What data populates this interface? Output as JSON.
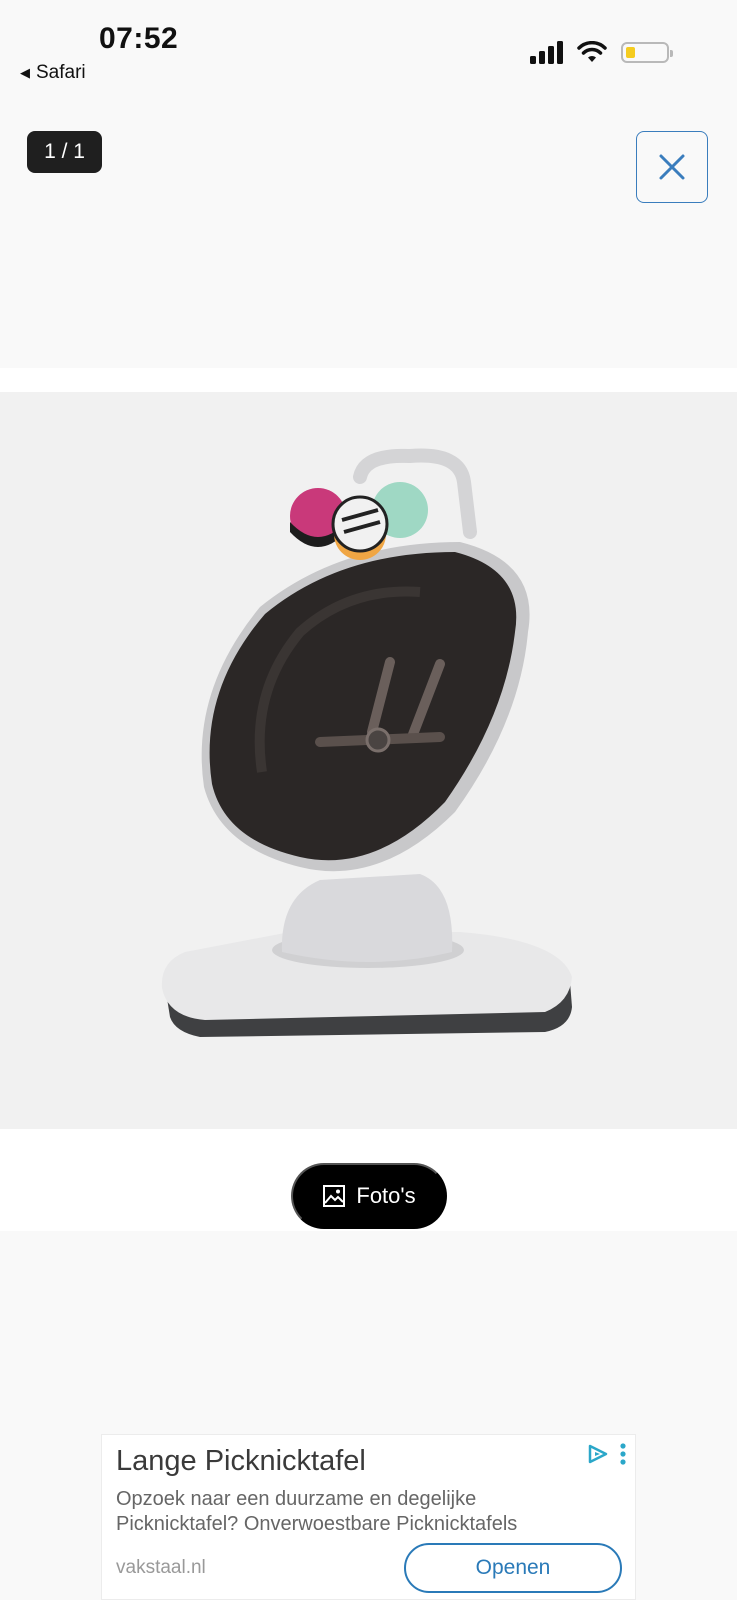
{
  "status_bar": {
    "time": "07:52",
    "back_label": "Safari",
    "battery_color": "#f5cc1f"
  },
  "gallery": {
    "counter": "1 / 1",
    "close_icon": "close-icon",
    "image_description_icon": "product-photo",
    "photos_button_label": "Foto's",
    "photos_icon": "image-icon",
    "accent_color": "#3a7dbd"
  },
  "ad": {
    "title": "Lange Picknicktafel",
    "body": "Opzoek naar een duurzame en degelijke Picknicktafel? Onverwoestbare Picknicktafels",
    "domain": "vakstaal.nl",
    "cta_label": "Openen",
    "adchoices_icon": "adchoices-icon",
    "menu_icon": "more-vertical-icon",
    "accent_color": "#2a7ab8"
  }
}
